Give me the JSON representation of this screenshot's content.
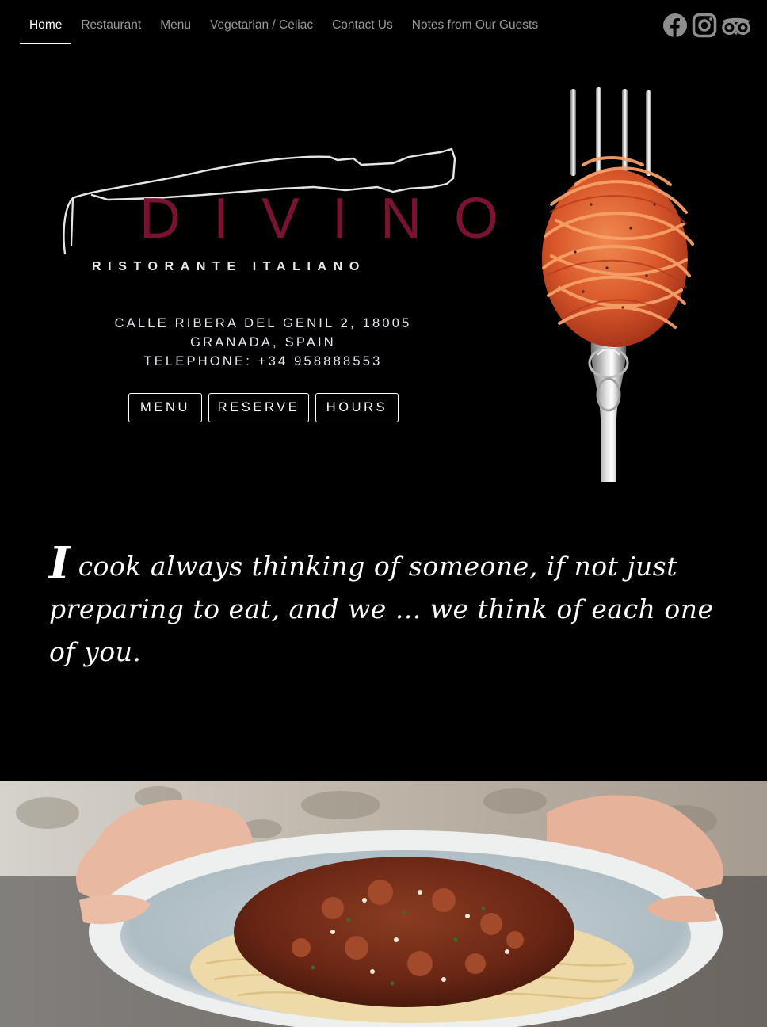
{
  "nav": {
    "items": [
      {
        "label": "Home",
        "active": true
      },
      {
        "label": "Restaurant",
        "active": false
      },
      {
        "label": "Menu",
        "active": false
      },
      {
        "label": "Vegetarian / Celiac",
        "active": false
      },
      {
        "label": "Contact Us",
        "active": false
      },
      {
        "label": "Notes from Our Guests",
        "active": false
      }
    ],
    "social": [
      "facebook-icon",
      "instagram-icon",
      "tripadvisor-icon"
    ]
  },
  "logo": {
    "brand": "DIVINO",
    "subtitle": "RISTORANTE ITALIANO"
  },
  "address": {
    "line1": "CALLE RIBERA DEL GENIL 2, 18005",
    "line2": "GRANADA, SPAIN",
    "phone": "TELEPHONE: +34 958888553"
  },
  "buttons": {
    "menu": "MENU",
    "reserve": "RESERVE",
    "hours": "HOURS"
  },
  "quote": {
    "dropcap": "I",
    "text": "cook always thinking of someone, if not just preparing to eat, and we ... we think of each one of you."
  },
  "colors": {
    "background": "#000000",
    "brand": "#7a1232",
    "nav_inactive": "#9b9b9b",
    "text": "#ffffff"
  }
}
